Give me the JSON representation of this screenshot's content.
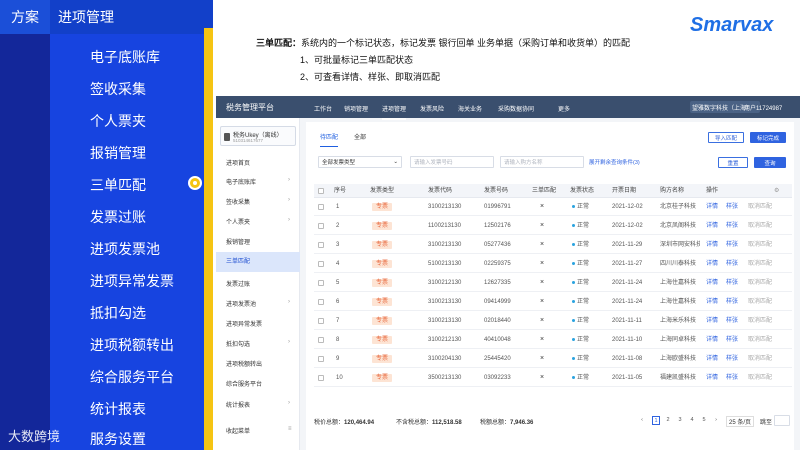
{
  "slide": {
    "tag": "方案",
    "title": "进项管理",
    "menu": [
      "电子底账库",
      "签收采集",
      "个人票夹",
      "报销管理",
      "三单匹配",
      "发票过账",
      "进项发票池",
      "进项异常发票",
      "抵扣勾选",
      "进项税额转出",
      "综合服务平台",
      "统计报表",
      "服务设置"
    ],
    "watermark": "大数跨境",
    "logo": "Smarvax",
    "desc_title": "三单匹配：",
    "desc_main": "系统内的一个标记状态，标记发票 银行回单 业务单据（采购订单和收货单）的匹配",
    "desc_l1": "1、可批量标记三单匹配状态",
    "desc_l2": "2、可查看详情、样张、即取消匹配"
  },
  "app": {
    "brand": "税务管理平台",
    "nav": [
      "工作台",
      "销项管理",
      "进项管理",
      "发票风险",
      "海关业务",
      "采购数据协同",
      "更多"
    ],
    "company": "望雅数字科技（上海）",
    "user": "用户11724987",
    "ukey_name": "税务Ukey（离线）",
    "ukey_id": "510314617677",
    "side": [
      "进项首页",
      "电子底账库",
      "签收采集",
      "个人票夹",
      "报销管理",
      "三单匹配",
      "发票过账",
      "进项发票池",
      "进项异常发票",
      "抵扣勾选",
      "进项税额转出",
      "综合服务平台",
      "统计报表",
      "收起菜单"
    ],
    "tabs": [
      "待匹配",
      "全部"
    ],
    "btn_import": "导入匹配",
    "btn_mark": "标记完成",
    "filter_type": "全部发票类型",
    "ph_code": "请输入发票号码",
    "ph_seller": "请输入购方名称",
    "filter_more": "展开剩余查询条件(3)",
    "btn_reset": "重置",
    "btn_query": "查询",
    "columns": [
      "序号",
      "发票类型",
      "发票代码",
      "发票号码",
      "三单匹配",
      "发票状态",
      "开票日期",
      "购方名称",
      "操作"
    ],
    "rows": [
      {
        "no": "1",
        "type": "专票",
        "code": "3100213130",
        "num": "01996791",
        "match": "×",
        "status": "正常",
        "date": "2021-12-02",
        "buyer": "北京桂子科技"
      },
      {
        "no": "2",
        "type": "专票",
        "code": "1100213130",
        "num": "12502176",
        "match": "×",
        "status": "正常",
        "date": "2021-12-02",
        "buyer": "北京凤阁科技"
      },
      {
        "no": "3",
        "type": "专票",
        "code": "3100213130",
        "num": "05277436",
        "match": "×",
        "status": "正常",
        "date": "2021-11-29",
        "buyer": "深圳市网安科技"
      },
      {
        "no": "4",
        "type": "专票",
        "code": "5100213130",
        "num": "02259375",
        "match": "×",
        "status": "正常",
        "date": "2021-11-27",
        "buyer": "四川川泰科技"
      },
      {
        "no": "5",
        "type": "专票",
        "code": "3100212130",
        "num": "12627335",
        "match": "×",
        "status": "正常",
        "date": "2021-11-24",
        "buyer": "上海住嘉科技"
      },
      {
        "no": "6",
        "type": "专票",
        "code": "3100213130",
        "num": "09414999",
        "match": "×",
        "status": "正常",
        "date": "2021-11-24",
        "buyer": "上海住嘉科技"
      },
      {
        "no": "7",
        "type": "专票",
        "code": "3100213130",
        "num": "02018440",
        "match": "×",
        "status": "正常",
        "date": "2021-11-11",
        "buyer": "上海米乐科技"
      },
      {
        "no": "8",
        "type": "专票",
        "code": "3100212130",
        "num": "40410048",
        "match": "×",
        "status": "正常",
        "date": "2021-11-10",
        "buyer": "上海同卓科技"
      },
      {
        "no": "9",
        "type": "专票",
        "code": "3100204130",
        "num": "25445420",
        "match": "×",
        "status": "正常",
        "date": "2021-11-08",
        "buyer": "上海欧盛科技"
      },
      {
        "no": "10",
        "type": "专票",
        "code": "3500213130",
        "num": "03092233",
        "match": "×",
        "status": "正常",
        "date": "2021-11-05",
        "buyer": "福建凯盛科技"
      }
    ],
    "op_detail": "详情",
    "op_sample": "样张",
    "op_cancel": "取消匹配",
    "tax_total_label": "税价总额：",
    "tax_total": "120,464.94",
    "untaxed_label": "不含税总额：",
    "untaxed": "112,518.58",
    "tax_label": "税额总额：",
    "tax": "7,946.36",
    "pages": [
      "1",
      "2",
      "3",
      "4",
      "5"
    ],
    "page_size": "25 条/页",
    "goto": "跳至"
  }
}
